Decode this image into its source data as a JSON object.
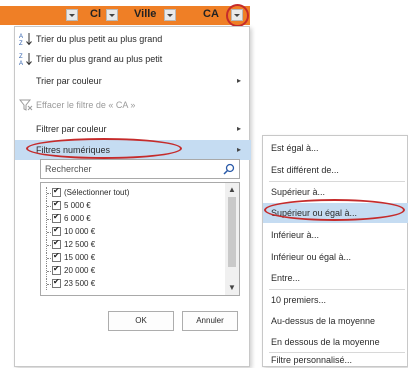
{
  "header": {
    "col1": "Cl",
    "col2": "Ville",
    "col3": "CA"
  },
  "menu": {
    "items": [
      {
        "label": "Trier du plus petit au plus grand",
        "icon": "sort-ascending-icon"
      },
      {
        "label": "Trier du plus grand au plus petit",
        "icon": "sort-descending-icon"
      },
      {
        "label": "Trier par couleur",
        "submenu": "▸"
      },
      {
        "label": "Effacer le filtre de « CA »",
        "icon": "clear-filter-icon",
        "disabled": true
      },
      {
        "label": "Filtrer par couleur",
        "submenu": "▸"
      },
      {
        "label": "Filtres numériques",
        "submenu": "▸",
        "highlighted": true
      }
    ]
  },
  "search": {
    "placeholder": "Rechercher",
    "icon": "search-icon"
  },
  "list": {
    "items": [
      "(Sélectionner tout)",
      "5 000 €",
      "6 000 €",
      "10 000 €",
      "12 500 €",
      "15 000 €",
      "20 000 €",
      "23 500 €"
    ],
    "scroll_up": "▲",
    "scroll_down": "▼"
  },
  "buttons": {
    "ok": "OK",
    "cancel": "Annuler"
  },
  "submenu": {
    "items": [
      "Est égal à...",
      "Est différent de...",
      "Supérieur à...",
      "Supérieur ou égal à...",
      "Inférieur à...",
      "Inférieur ou égal à...",
      "Entre...",
      "10 premiers...",
      "Au-dessus de la moyenne",
      "En dessous de la moyenne",
      "Filtre personnalisé..."
    ]
  },
  "colors": {
    "header_orange": "#ef7f26",
    "highlight": "#c5dcf2",
    "annotation_red": "#c52b2b"
  }
}
